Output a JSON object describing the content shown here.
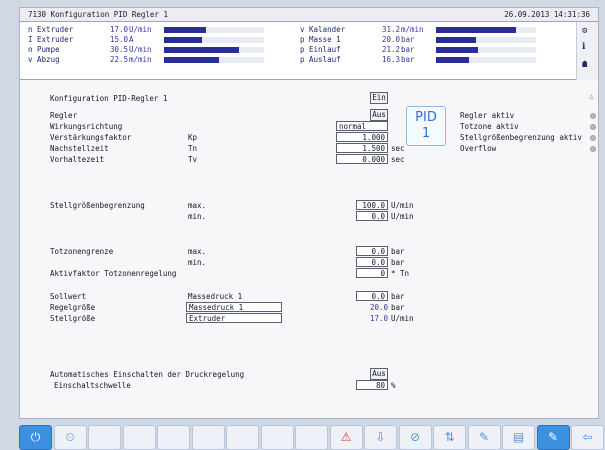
{
  "window": {
    "title": "7130 Konfiguration PID Regler 1",
    "datetime": "26.09.2013 14:31:36"
  },
  "gauges_left": [
    {
      "label": "n Extruder",
      "value": "17.0",
      "unit": "U/min",
      "fill": 0.42
    },
    {
      "label": "I Extruder",
      "value": "15.0",
      "unit": "A",
      "fill": 0.38
    },
    {
      "label": "n Pumpe",
      "value": "30.5",
      "unit": "U/min",
      "fill": 0.75
    },
    {
      "label": "v Abzug",
      "value": "22.5",
      "unit": "m/min",
      "fill": 0.55
    }
  ],
  "gauges_right": [
    {
      "label": "v Kalander",
      "value": "31.2",
      "unit": "m/min",
      "fill": 0.8
    },
    {
      "label": "p Masse 1",
      "value": "20.0",
      "unit": "bar",
      "fill": 0.4
    },
    {
      "label": "p Einlauf",
      "value": "21.2",
      "unit": "bar",
      "fill": 0.42
    },
    {
      "label": "p Auslauf",
      "value": "16.3",
      "unit": "bar",
      "fill": 0.33
    }
  ],
  "header": {
    "label": "Konfiguration PID-Regler 1",
    "state": "Ein"
  },
  "pid_tile": {
    "line1": "PID",
    "line2": "1"
  },
  "regler": {
    "label": "Regler",
    "value": "Aus",
    "wirk_label": "Wirkungsrichtung",
    "wirk_value": "normal",
    "kp_label": "Verstärkungsfaktor",
    "kp_sym": "Kp",
    "kp_value": "1.000",
    "tn_label": "Nachstellzeit",
    "tn_sym": "Tn",
    "tn_value": "1.500",
    "tn_unit": "sec",
    "tv_label": "Vorhaltezeit",
    "tv_sym": "Tv",
    "tv_value": "0.000",
    "tv_unit": "sec"
  },
  "status": [
    {
      "label": "Regler aktiv"
    },
    {
      "label": "Totzone aktiv"
    },
    {
      "label": "Stellgrößenbegrenzung aktiv"
    },
    {
      "label": "Overflow"
    }
  ],
  "stell": {
    "label": "Stellgrößenbegrenzung",
    "max_label": "max.",
    "max_value": "100.0",
    "max_unit": "U/min",
    "min_label": "min.",
    "min_value": "0.0",
    "min_unit": "U/min"
  },
  "tot": {
    "label": "Totzonengrenze",
    "max_label": "max.",
    "max_value": "0.0",
    "max_unit": "bar",
    "min_label": "min.",
    "min_value": "0.0",
    "min_unit": "bar",
    "aktiv_label": "Aktivfaktor Totzonenregelung",
    "aktiv_value": "0",
    "aktiv_unit": "* Tn"
  },
  "signals": {
    "soll_label": "Sollwert",
    "soll_source": "Massedruck 1",
    "soll_value": "0.0",
    "soll_unit": "bar",
    "regel_label": "Regelgröße",
    "regel_source": "Massedruck 1",
    "regel_value": "20.0",
    "regel_unit": "bar",
    "stell_label": "Stellgröße",
    "stell_source": "Extruder",
    "stell_value": "17.0",
    "stell_unit": "U/min"
  },
  "auto": {
    "label": "Automatisches Einschalten der Druckregelung",
    "value": "Aus",
    "schwelle_label": "Einschaltschwelle",
    "schwelle_value": "80",
    "schwelle_unit": "%"
  },
  "toolbar": {
    "buttons": [
      {
        "name": "power-icon",
        "glyph": "⏻"
      },
      {
        "name": "timer-power-icon",
        "glyph": "⏲"
      },
      {
        "name": "empty-slot-1",
        "glyph": ""
      },
      {
        "name": "empty-slot-2",
        "glyph": ""
      },
      {
        "name": "empty-slot-3",
        "glyph": ""
      },
      {
        "name": "empty-slot-4",
        "glyph": ""
      },
      {
        "name": "empty-slot-5",
        "glyph": ""
      },
      {
        "name": "empty-slot-6",
        "glyph": ""
      },
      {
        "name": "empty-slot-7",
        "glyph": ""
      },
      {
        "name": "alarm-icon",
        "glyph": "⚠"
      },
      {
        "name": "download-icon",
        "glyph": "⇩"
      },
      {
        "name": "no-entry-icon",
        "glyph": "⊘"
      },
      {
        "name": "sort-icon",
        "glyph": "⇅"
      },
      {
        "name": "edit-pen-icon",
        "glyph": "✎"
      },
      {
        "name": "book-icon",
        "glyph": "▤"
      },
      {
        "name": "pen-active-icon",
        "glyph": "✎"
      },
      {
        "name": "back-icon",
        "glyph": "⇦"
      }
    ]
  }
}
